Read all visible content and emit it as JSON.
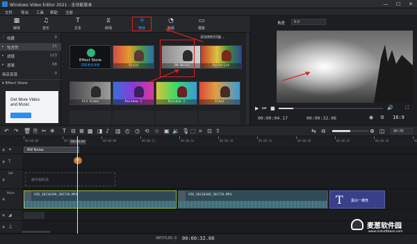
{
  "app": {
    "title": "Windows Video Editor 2021 - 全功能版本",
    "window_controls": [
      "—",
      "☐",
      "✕"
    ]
  },
  "menu": [
    "文件",
    "导出",
    "工具",
    "帮助",
    "注册"
  ],
  "tabs": [
    {
      "label": "媒体",
      "icon": "film-icon"
    },
    {
      "label": "音乐",
      "icon": "music-icon"
    },
    {
      "label": "文本",
      "icon": "text-icon"
    },
    {
      "label": "转场",
      "icon": "transition-icon"
    },
    {
      "label": "特效",
      "icon": "sparkle-icon",
      "active": true
    },
    {
      "label": "贴纸",
      "icon": "sticker-icon"
    },
    {
      "label": "模板",
      "icon": "template-icon"
    }
  ],
  "sidebar": {
    "items": [
      {
        "label": "收藏",
        "count": "0",
        "caret": "♡"
      },
      {
        "label": "包含的",
        "count": "15",
        "caret": "▸",
        "selected": true
      },
      {
        "label": "滤镜",
        "count": "123",
        "caret": "▸"
      },
      {
        "label": "遮罩",
        "count": "68",
        "caret": "▸"
      },
      {
        "label": "商店资源",
        "count": "0",
        "caret": ""
      }
    ],
    "store_label": "Effect Store",
    "promo_line1": "Get More Video",
    "promo_line2": "and Music"
  },
  "library": {
    "add_label": "添加到时间轴",
    "effects": [
      {
        "name": "获取更多效果",
        "store": true,
        "store_label": "Effect Store"
      },
      {
        "name": "Vivid"
      },
      {
        "name": "BW Noise",
        "highlighted": true
      },
      {
        "name": "Posterize"
      },
      {
        "name": "Old Video"
      },
      {
        "name": "Rainbow 1"
      },
      {
        "name": "Rainbow 2"
      },
      {
        "name": "Aikai"
      }
    ]
  },
  "preview": {
    "angle_label": "角度",
    "angle_value": "0.0",
    "current_time": "00:00:04.17",
    "total_time": "00:00:32.06",
    "aspect": "16:9",
    "progress": 0.14
  },
  "timeline": {
    "zoom": "00:05",
    "playhead_time": "00:00:04",
    "ruler_marks": [
      "00:00:00",
      "00:00:04",
      "00:00:08",
      "00:00:12",
      "00:00:16",
      "00:00:20",
      "00:00:24",
      "00:00:28",
      "00:00:32",
      "00:00:36",
      "00:00:40"
    ],
    "effect_clip": "BW Noise",
    "pip_hint": "画中画轨道",
    "main_label": "Main",
    "pip_label": "PIP",
    "video_clip_1": "VID_20210309_202728.MP4",
    "video_clip_2": "VID_20210309_202728.MP4",
    "title_clip": "黑白一棵竞"
  },
  "status": {
    "label": "UNTITLED_0",
    "duration": "00:00:32.08",
    "watermark_name": "麦葱软件园",
    "watermark_url": "www.mdsoftbase.com"
  }
}
